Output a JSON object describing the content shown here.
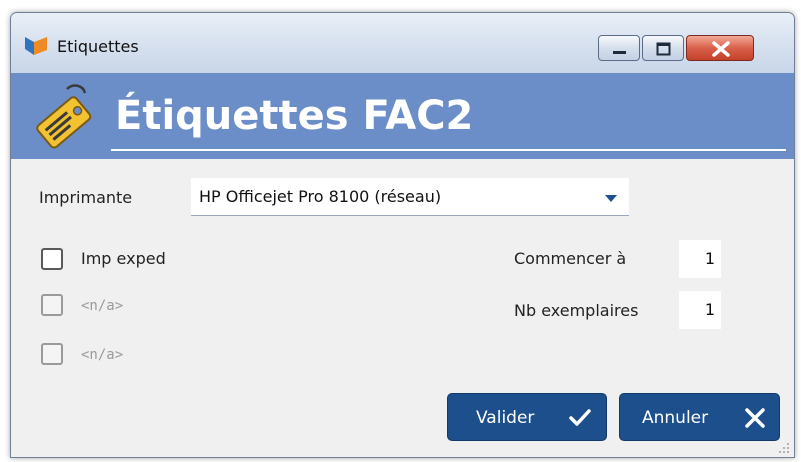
{
  "window": {
    "title": "Etiquettes"
  },
  "header": {
    "title": "Étiquettes FAC2",
    "background_color": "#6b8ec9",
    "icon": "price-tag-icon"
  },
  "form": {
    "printer_label": "Imprimante",
    "printer_value": "HP Officejet Pro 8100 (réseau)",
    "checkboxes": [
      {
        "label": "Imp exped",
        "checked": false,
        "enabled": true
      },
      {
        "label": "<n/a>",
        "checked": false,
        "enabled": false
      },
      {
        "label": "<n/a>",
        "checked": false,
        "enabled": false
      }
    ],
    "start_label": "Commencer à",
    "start_value": "1",
    "copies_label": "Nb exemplaires",
    "copies_value": "1"
  },
  "buttons": {
    "validate_label": "Valider",
    "cancel_label": "Annuler",
    "button_color": "#1c4f8c"
  }
}
